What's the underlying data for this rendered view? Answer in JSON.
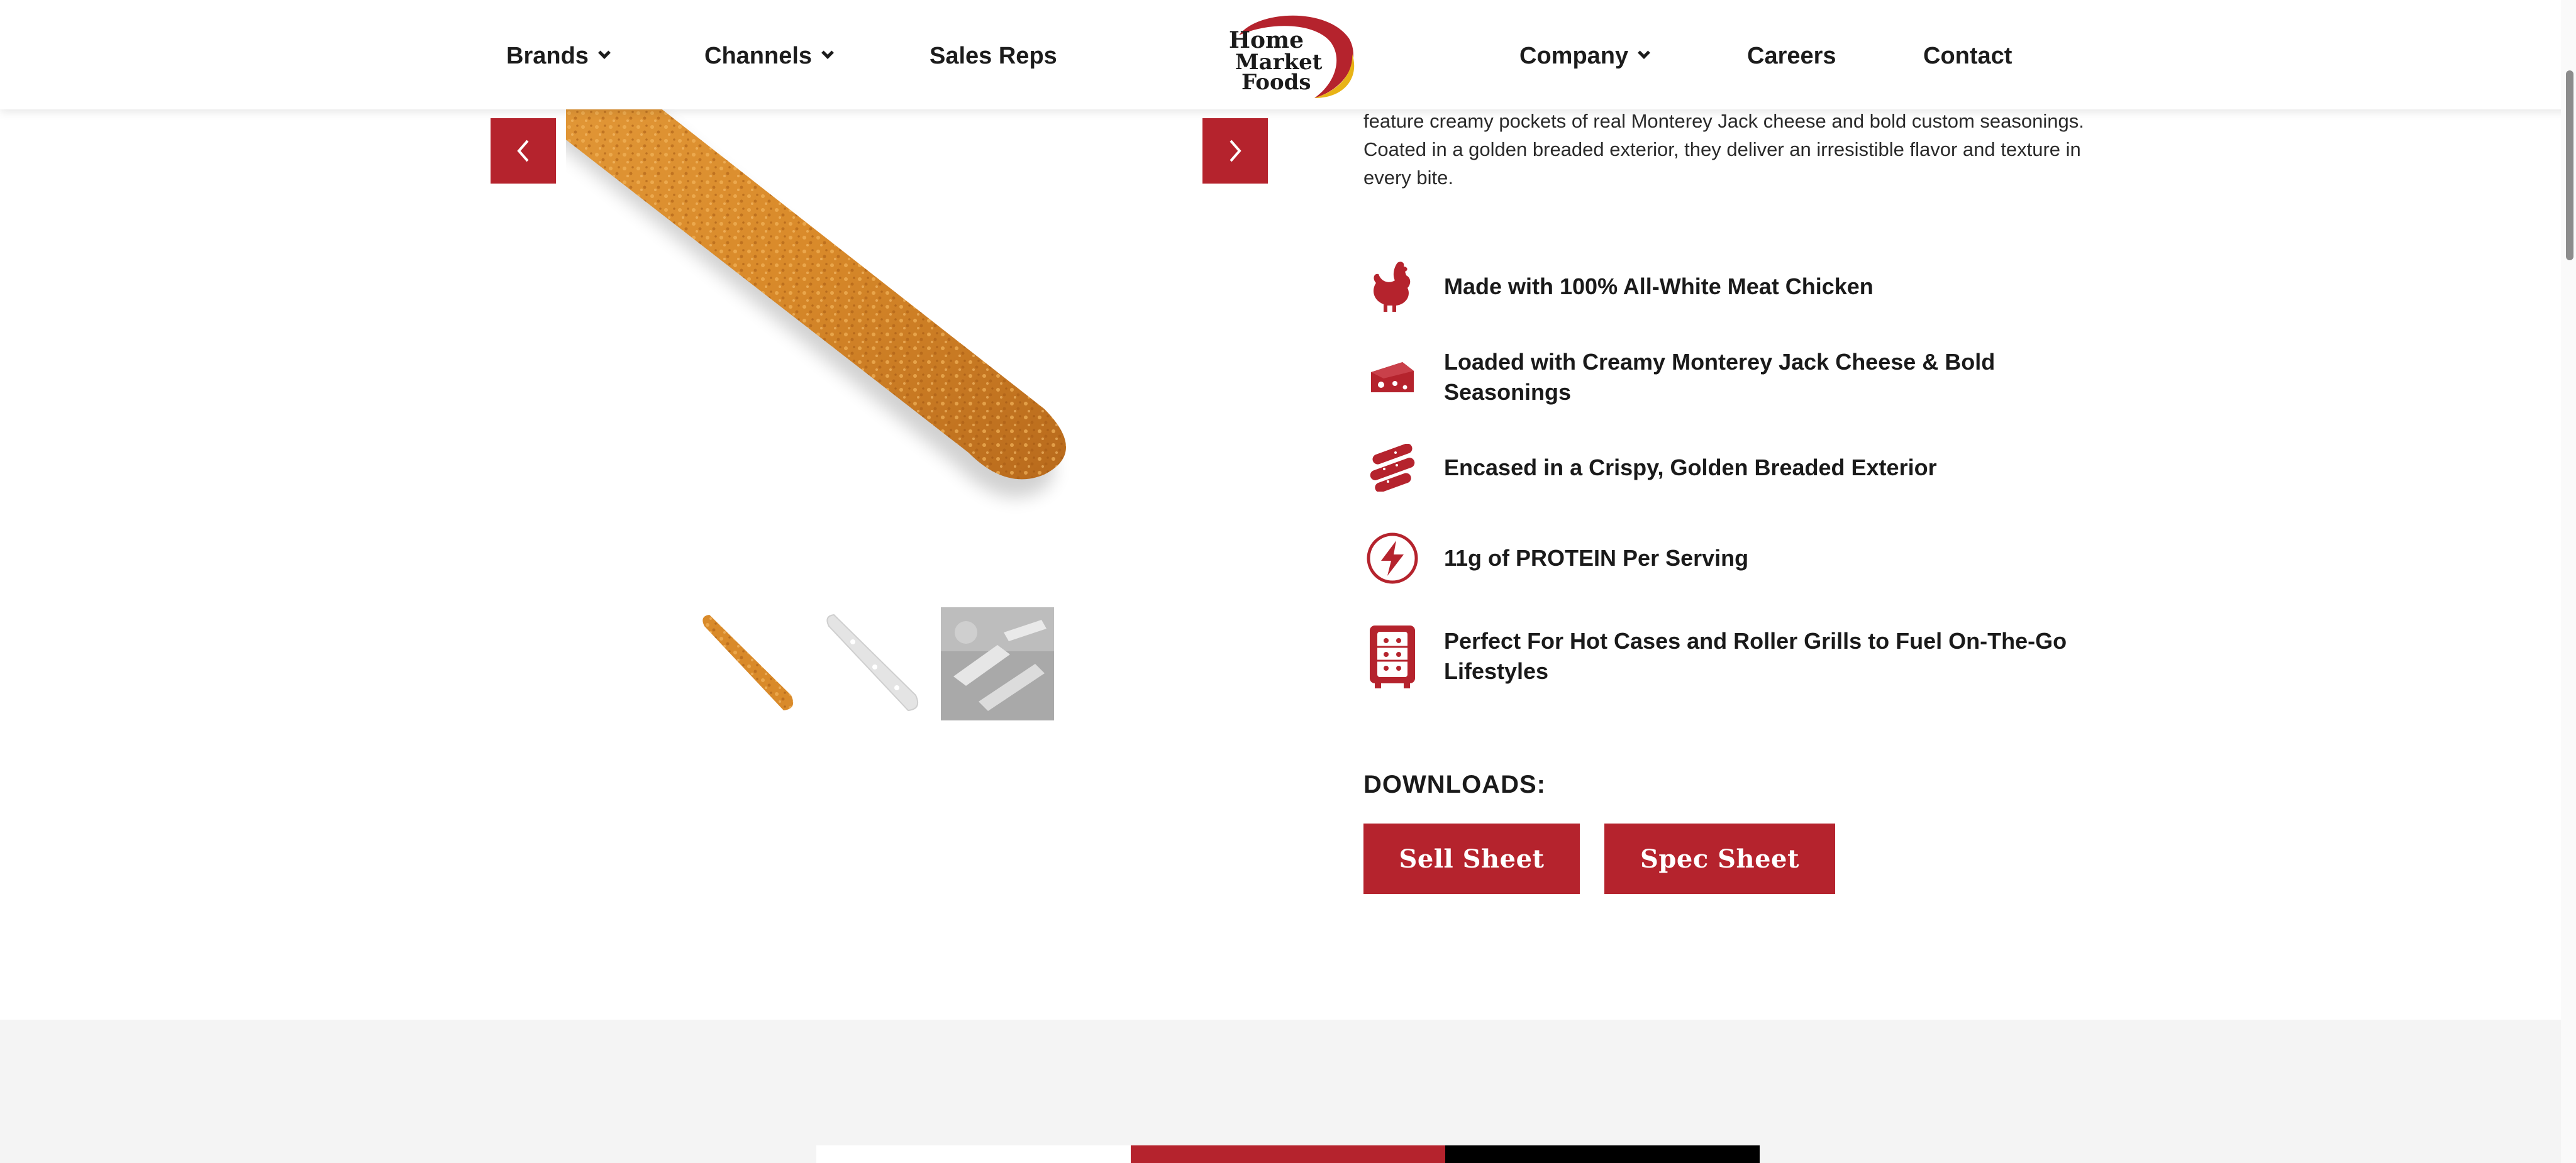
{
  "header": {
    "nav_left": [
      {
        "label": "Brands",
        "has_dropdown": true
      },
      {
        "label": "Channels",
        "has_dropdown": true
      },
      {
        "label": "Sales Reps",
        "has_dropdown": false
      }
    ],
    "logo": {
      "line1": "Home",
      "line2": "Market",
      "line3": "Foods"
    },
    "nav_right": [
      {
        "label": "Company",
        "has_dropdown": true
      },
      {
        "label": "Careers",
        "has_dropdown": false
      },
      {
        "label": "Contact",
        "has_dropdown": false
      }
    ]
  },
  "carousel": {
    "prev_icon": "chevron-left-icon",
    "next_icon": "chevron-right-icon",
    "thumbnails": [
      "fried-stick",
      "frozen-stick",
      "packaged-sticks"
    ]
  },
  "product": {
    "description": "feature creamy pockets of real Monterey Jack cheese and bold custom seasonings. Coated in a golden breaded exterior, they deliver an irresistible flavor and texture in every bite.",
    "features": [
      {
        "icon": "chicken-icon",
        "text": "Made with 100% All-White Meat Chicken"
      },
      {
        "icon": "cheese-icon",
        "text": "Loaded with Creamy Monterey Jack Cheese & Bold Seasonings"
      },
      {
        "icon": "breaded-sticks-icon",
        "text": "Encased in a Crispy, Golden Breaded Exterior"
      },
      {
        "icon": "protein-bolt-icon",
        "text": "11g of PROTEIN Per Serving"
      },
      {
        "icon": "hot-case-icon",
        "text": "Perfect For Hot Cases and Roller Grills to Fuel On-The-Go Lifestyles"
      }
    ]
  },
  "downloads": {
    "label": "DOWNLOADS:",
    "buttons": [
      "Sell Sheet",
      "Spec Sheet"
    ]
  },
  "colors": {
    "brand_red": "#b5232d",
    "gray_bg": "#f4f4f4",
    "dark": "#1a1a1a"
  }
}
